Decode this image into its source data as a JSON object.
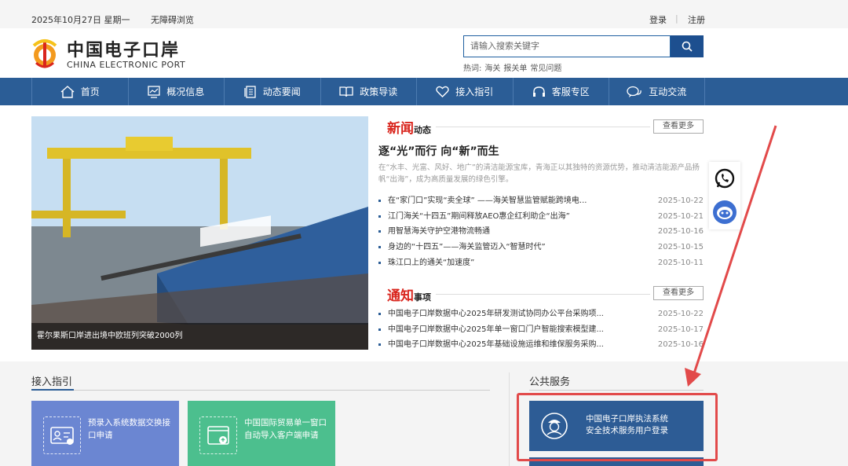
{
  "topbar": {
    "date": "2025年10月27日 星期一",
    "accessibility": "无障碍浏览",
    "login": "登录",
    "separator": "|",
    "register": "注册"
  },
  "header": {
    "logo_cn": "中国电子口岸",
    "logo_en": "CHINA ELECTRONIC PORT",
    "search_placeholder": "请输入搜索关键字",
    "hot_label": "热词:",
    "hot_words": [
      "海关",
      "报关单",
      "常见问题"
    ]
  },
  "nav": {
    "items": [
      {
        "label": "首页",
        "icon": "home-icon"
      },
      {
        "label": "概况信息",
        "icon": "chart-icon"
      },
      {
        "label": "动态要闻",
        "icon": "document-icon"
      },
      {
        "label": "政策导读",
        "icon": "book-icon"
      },
      {
        "label": "接入指引",
        "icon": "heart-icon"
      },
      {
        "label": "客服专区",
        "icon": "headset-icon"
      },
      {
        "label": "互动交流",
        "icon": "chat-icon"
      }
    ]
  },
  "banner": {
    "caption": "霍尔果斯口岸进出境中欧班列突破2000列"
  },
  "news": {
    "title_big": "新闻",
    "title_small": "动态",
    "more": "查看更多",
    "headline": "逐“光”而行 向“新”而生",
    "summary": "在“水丰、光富、风好、地广”的清洁能源宝库，青海正以其独特的资源优势，推动清洁能源产品扬帆“出海”，成为高质量发展的绿色引擎。",
    "items": [
      {
        "title": "在“家门口”实现“卖全球” ——海关智慧监管赋能跨境电...",
        "date": "2025-10-22"
      },
      {
        "title": "江门海关“十四五”期间释放AEO惠企红利助企“出海”",
        "date": "2025-10-21"
      },
      {
        "title": "用智慧海关守护空港物流畅通",
        "date": "2025-10-16"
      },
      {
        "title": "身边的“十四五”——海关监管迈入“智慧时代”",
        "date": "2025-10-15"
      },
      {
        "title": "珠江口上的通关“加速度”",
        "date": "2025-10-11"
      }
    ]
  },
  "notice": {
    "title_big": "通知",
    "title_small": "事项",
    "more": "查看更多",
    "items": [
      {
        "title": "中国电子口岸数据中心2025年研发测试协同办公平台采购项...",
        "date": "2025-10-22"
      },
      {
        "title": "中国电子口岸数据中心2025年单一窗口门户智能搜索模型建...",
        "date": "2025-10-17"
      },
      {
        "title": "中国电子口岸数据中心2025年基础设施运维和维保服务采购...",
        "date": "2025-10-16"
      }
    ]
  },
  "access_guide": {
    "title": "接入指引",
    "cards": [
      {
        "label": "预录入系统数据交换接口申请",
        "color": "#6b86d2"
      },
      {
        "label": "中国国际贸易单一窗口自动导入客户端申请",
        "color": "#4cbf8e"
      }
    ]
  },
  "public_service": {
    "title": "公共服务",
    "item_line1": "中国电子口岸执法系统",
    "item_line2": "安全技术服务用户登录"
  },
  "colors": {
    "brand_blue": "#2b5d96",
    "news_red": "#d9251d",
    "highlight_red": "#e24a4a"
  }
}
